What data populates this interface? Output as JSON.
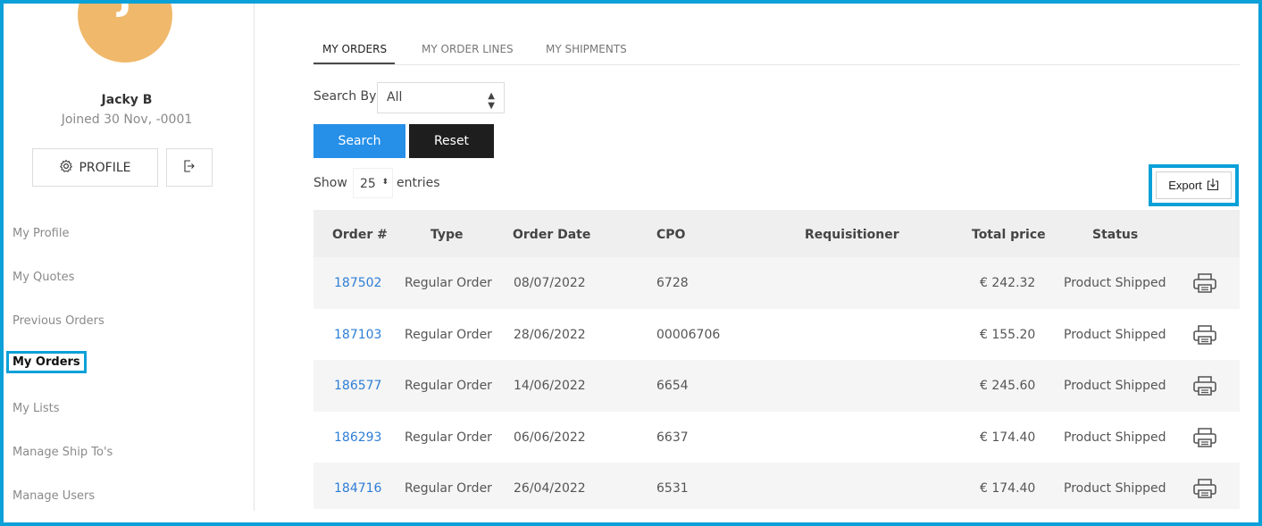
{
  "user": {
    "initial": "J",
    "name": "Jacky B",
    "joined": "Joined 30 Nov, -0001",
    "avatar_color": "#f0b86a"
  },
  "sidebar": {
    "profile_button": "PROFILE",
    "profile_icon": "gear-icon",
    "logout_icon": "logout-icon",
    "items": [
      {
        "label": "My Profile"
      },
      {
        "label": "My Quotes"
      },
      {
        "label": "Previous Orders"
      },
      {
        "label": "My Orders"
      },
      {
        "label": "My Lists"
      },
      {
        "label": "Manage Ship To's"
      },
      {
        "label": "Manage Users"
      }
    ]
  },
  "tabs": [
    {
      "label": "MY ORDERS"
    },
    {
      "label": "MY ORDER LINES"
    },
    {
      "label": "MY SHIPMENTS"
    }
  ],
  "filters": {
    "search_by_label": "Search By",
    "search_by_value": "All",
    "search_button": "Search",
    "reset_button": "Reset",
    "show_label": "Show",
    "entries_value": "25",
    "entries_label": "entries",
    "export_button": "Export",
    "export_icon": "download-icon"
  },
  "table": {
    "headers": [
      "Order #",
      "Type",
      "Order Date",
      "CPO",
      "Requisitioner",
      "Total price",
      "Status"
    ],
    "rows": [
      {
        "order": "187502",
        "type": "Regular Order",
        "date": "08/07/2022",
        "cpo": "6728",
        "requisitioner": "",
        "total": "€ 242.32",
        "status": "Product Shipped"
      },
      {
        "order": "187103",
        "type": "Regular Order",
        "date": "28/06/2022",
        "cpo": "00006706",
        "requisitioner": "",
        "total": "€ 155.20",
        "status": "Product Shipped"
      },
      {
        "order": "186577",
        "type": "Regular Order",
        "date": "14/06/2022",
        "cpo": "6654",
        "requisitioner": "",
        "total": "€ 245.60",
        "status": "Product Shipped"
      },
      {
        "order": "186293",
        "type": "Regular Order",
        "date": "06/06/2022",
        "cpo": "6637",
        "requisitioner": "",
        "total": "€ 174.40",
        "status": "Product Shipped"
      },
      {
        "order": "184716",
        "type": "Regular Order",
        "date": "26/04/2022",
        "cpo": "6531",
        "requisitioner": "",
        "total": "€ 174.40",
        "status": "Product Shipped"
      }
    ]
  },
  "colors": {
    "highlight": "#0aa0d8",
    "primary": "#2690e8",
    "dark": "#1e1e1e",
    "link": "#2e7ed6"
  }
}
